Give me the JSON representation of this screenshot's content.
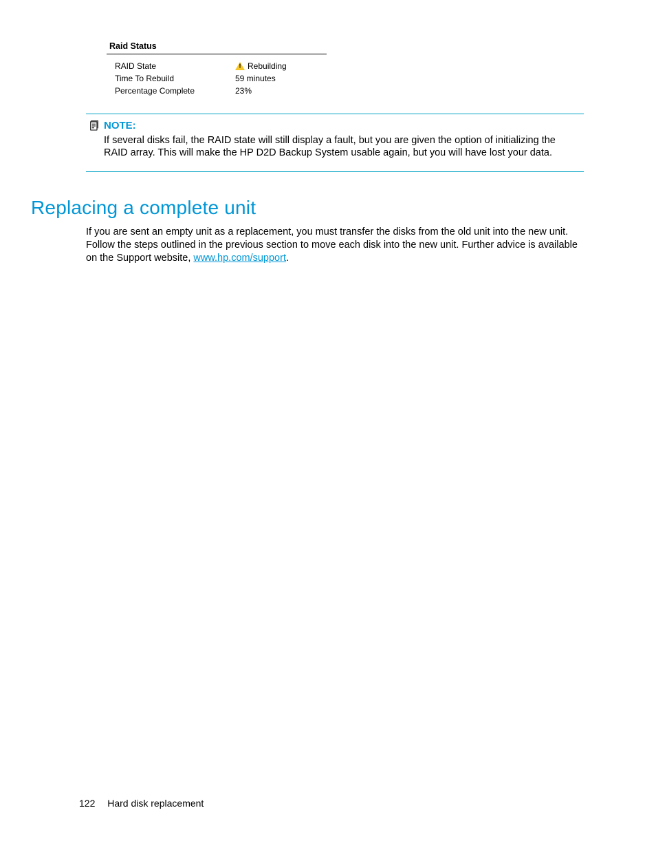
{
  "raidPanel": {
    "title": "Raid Status",
    "rows": [
      {
        "label": "RAID State",
        "value": "Rebuilding",
        "warn": true
      },
      {
        "label": "Time To Rebuild",
        "value": "59 minutes",
        "warn": false
      },
      {
        "label": "Percentage Complete",
        "value": "23%",
        "warn": false
      }
    ]
  },
  "note": {
    "label": "NOTE:",
    "body": "If several disks fail, the RAID state will still display a fault, but you are given the option of initializing the RAID array. This will make the HP D2D Backup System usable again, but you will have lost your data."
  },
  "section": {
    "heading": "Replacing a complete unit",
    "bodyPrefix": "If you are sent an empty unit as a replacement, you must transfer the disks from the old unit into the new unit. Follow the steps outlined in the previous section to move each disk into the new unit. Further advice is available on the Support website, ",
    "linkText": "www.hp.com/support",
    "bodySuffix": "."
  },
  "footer": {
    "pageNumber": "122",
    "chapter": "Hard disk replacement"
  }
}
